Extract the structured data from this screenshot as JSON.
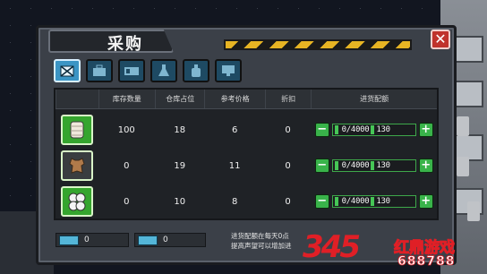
{
  "window": {
    "title": "采购",
    "close_label": "✕"
  },
  "tabs": [
    {
      "icon": "crate-icon",
      "active": true
    },
    {
      "icon": "toolbox-icon",
      "active": false
    },
    {
      "icon": "container-icon",
      "active": false
    },
    {
      "icon": "flask-icon",
      "active": false
    },
    {
      "icon": "bottle-icon",
      "active": false
    },
    {
      "icon": "monitor-icon",
      "active": false
    }
  ],
  "table": {
    "headers": [
      "",
      "库存数量",
      "仓库占位",
      "参考价格",
      "折扣",
      "进货配额"
    ],
    "rows": [
      {
        "icon": "paper-roll-icon",
        "stock": "100",
        "space": "18",
        "price": "6",
        "discount": "0",
        "quantity": "0",
        "separator": "/",
        "max": "4000",
        "quota": "130"
      },
      {
        "icon": "leather-icon",
        "stock": "0",
        "space": "19",
        "price": "11",
        "discount": "0",
        "quantity": "0",
        "separator": "/",
        "max": "4000",
        "quota": "130"
      },
      {
        "icon": "toilet-paper-icon",
        "stock": "0",
        "space": "10",
        "price": "8",
        "discount": "0",
        "quantity": "0",
        "separator": "/",
        "max": "4000",
        "quota": "130"
      }
    ],
    "minus_label": "−",
    "plus_label": "+"
  },
  "footer": {
    "currency1_value": "0",
    "currency2_value": "0",
    "note_line1": "进货配额在每天0点",
    "note_line2": "提高声望可以增加进"
  },
  "watermark": {
    "number": "345",
    "name": "红鼎游戏",
    "url": "688788"
  },
  "colors": {
    "accent_green": "#39b34a",
    "tab_active": "#3b95c4",
    "close_red": "#c0332c",
    "hazard_yellow": "#e7b423"
  }
}
